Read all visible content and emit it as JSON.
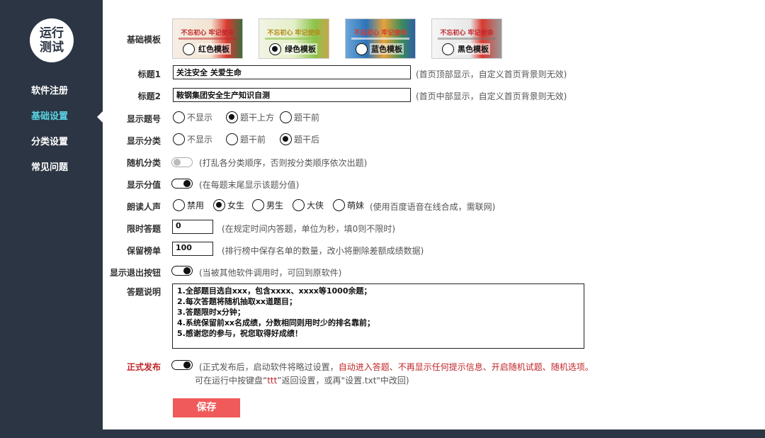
{
  "app": {
    "logo_line1": "运行",
    "logo_line2": "测试"
  },
  "sidebar": {
    "items": [
      {
        "label": "软件注册"
      },
      {
        "label": "基础设置"
      },
      {
        "label": "分类设置"
      },
      {
        "label": "常见问题"
      }
    ],
    "active_index": 1,
    "active_color": "#59d4e3"
  },
  "form": {
    "template": {
      "label": "基础模板",
      "options": [
        {
          "label": "红色模板",
          "banner": "不忘初心 牢记使命",
          "selected": false
        },
        {
          "label": "绿色模板",
          "banner": "不忘初心 牢记使命",
          "selected": true
        },
        {
          "label": "蓝色模板",
          "banner": "不忘初心 牢记使命",
          "selected": false
        },
        {
          "label": "黑色模板",
          "banner": "不忘初心 牢记使命",
          "selected": false
        }
      ]
    },
    "title1": {
      "label": "标题1",
      "value": "关注安全   关爱生命",
      "hint": "(首页顶部显示，自定义首页背景则无效)"
    },
    "title2": {
      "label": "标题2",
      "value": "鞍钢集团安全生产知识自测",
      "hint": "(首页中部显示，自定义首页背景则无效)"
    },
    "show_number": {
      "label": "显示题号",
      "options": [
        "不显示",
        "题干上方",
        "题干前"
      ],
      "selected": 1
    },
    "show_category": {
      "label": "显示分类",
      "options": [
        "不显示",
        "题干前",
        "题干后"
      ],
      "selected": 2
    },
    "random_category": {
      "label": "随机分类",
      "enabled": false,
      "hint": "(打乱各分类顺序，否则按分类顺序依次出题)"
    },
    "show_score": {
      "label": "显示分值",
      "enabled": true,
      "hint": "(在每题末尾显示该题分值)"
    },
    "voice": {
      "label": "朗读人声",
      "options": [
        "禁用",
        "女生",
        "男生",
        "大侠",
        "萌妹"
      ],
      "selected": 1,
      "hint": "(使用百度语音在线合成，需联网)"
    },
    "time_limit": {
      "label": "限时答题",
      "value": "0",
      "hint": "(在规定时间内答题，单位为秒，填0则不限时)"
    },
    "leaderboard": {
      "label": "保留榜单",
      "value": "100",
      "hint": "(排行榜中保存名单的数量，改小将删除差额成绩数据)"
    },
    "exit_button": {
      "label": "显示退出按钮",
      "enabled": true,
      "hint": "(当被其他软件调用时，可回到原软件)"
    },
    "instructions": {
      "label": "答题说明",
      "lines": [
        "1.全部题目选自xxx，包含xxxx、xxxx等1000余题；",
        "2.每次答题将随机抽取xx道题目；",
        "3.答题限时x分钟；",
        "4.系统保留前xx名成绩，分数相同则用时少的排名靠前；",
        "5.感谢您的参与，祝您取得好成绩！"
      ]
    },
    "publish": {
      "label": "正式发布",
      "enabled": true,
      "hint_prefix": "(正式发布后，启动软件将略过设置，",
      "hint_red": "自动进入答题、不再显示任何提示信息、开启随机试题、随机选项。",
      "hint_line2_a": "可在运行中按键盘“",
      "hint_line2_key": "ttt",
      "hint_line2_b": "”返回设置，或再\"设置.txt\"中改回)"
    },
    "save_label": "保存"
  },
  "colors": {
    "sidebar_bg": "#2b3543",
    "accent": "#59d4e3",
    "danger": "#c0262b",
    "save_button": "#f05a5a"
  }
}
